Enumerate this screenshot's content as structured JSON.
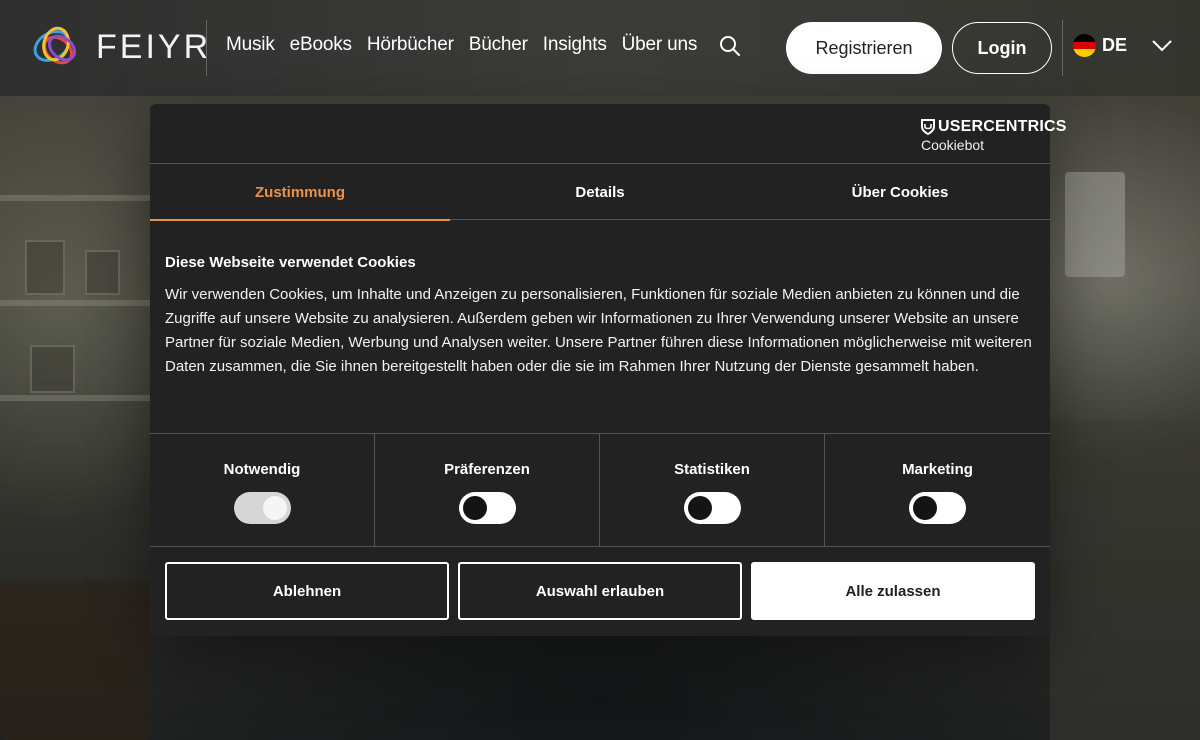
{
  "header": {
    "brand": "FEIYR",
    "nav": [
      "Musik",
      "eBooks",
      "Hörbücher",
      "Bücher",
      "Insights",
      "Über uns"
    ],
    "register_label": "Registrieren",
    "login_label": "Login",
    "language": "DE"
  },
  "cookie_dialog": {
    "provider_name": "USERCENTRICS",
    "provider_sub": "Cookiebot",
    "tabs": [
      "Zustimmung",
      "Details",
      "Über Cookies"
    ],
    "active_tab": "Zustimmung",
    "heading": "Diese Webseite verwendet Cookies",
    "body": "Wir verwenden Cookies, um Inhalte und Anzeigen zu personalisieren, Funktionen für soziale Medien anbieten zu können und die Zugriffe auf unsere Website zu analysieren. Außerdem geben wir Informationen zu Ihrer Verwendung unserer Website an unsere Partner für soziale Medien, Werbung und Analysen weiter. Unsere Partner führen diese Informationen möglicherweise mit weiteren Daten zusammen, die Sie ihnen bereitgestellt haben oder die sie im Rahmen Ihrer Nutzung der Dienste gesammelt haben.",
    "categories": [
      {
        "label": "Notwendig",
        "state": "on-disabled"
      },
      {
        "label": "Präferenzen",
        "state": "off"
      },
      {
        "label": "Statistiken",
        "state": "off"
      },
      {
        "label": "Marketing",
        "state": "off"
      }
    ],
    "buttons": {
      "decline": "Ablehnen",
      "allow_selection": "Auswahl erlauben",
      "allow_all": "Alle zulassen"
    }
  },
  "colors": {
    "accent": "#e8924a",
    "dialog_bg": "#222222"
  }
}
